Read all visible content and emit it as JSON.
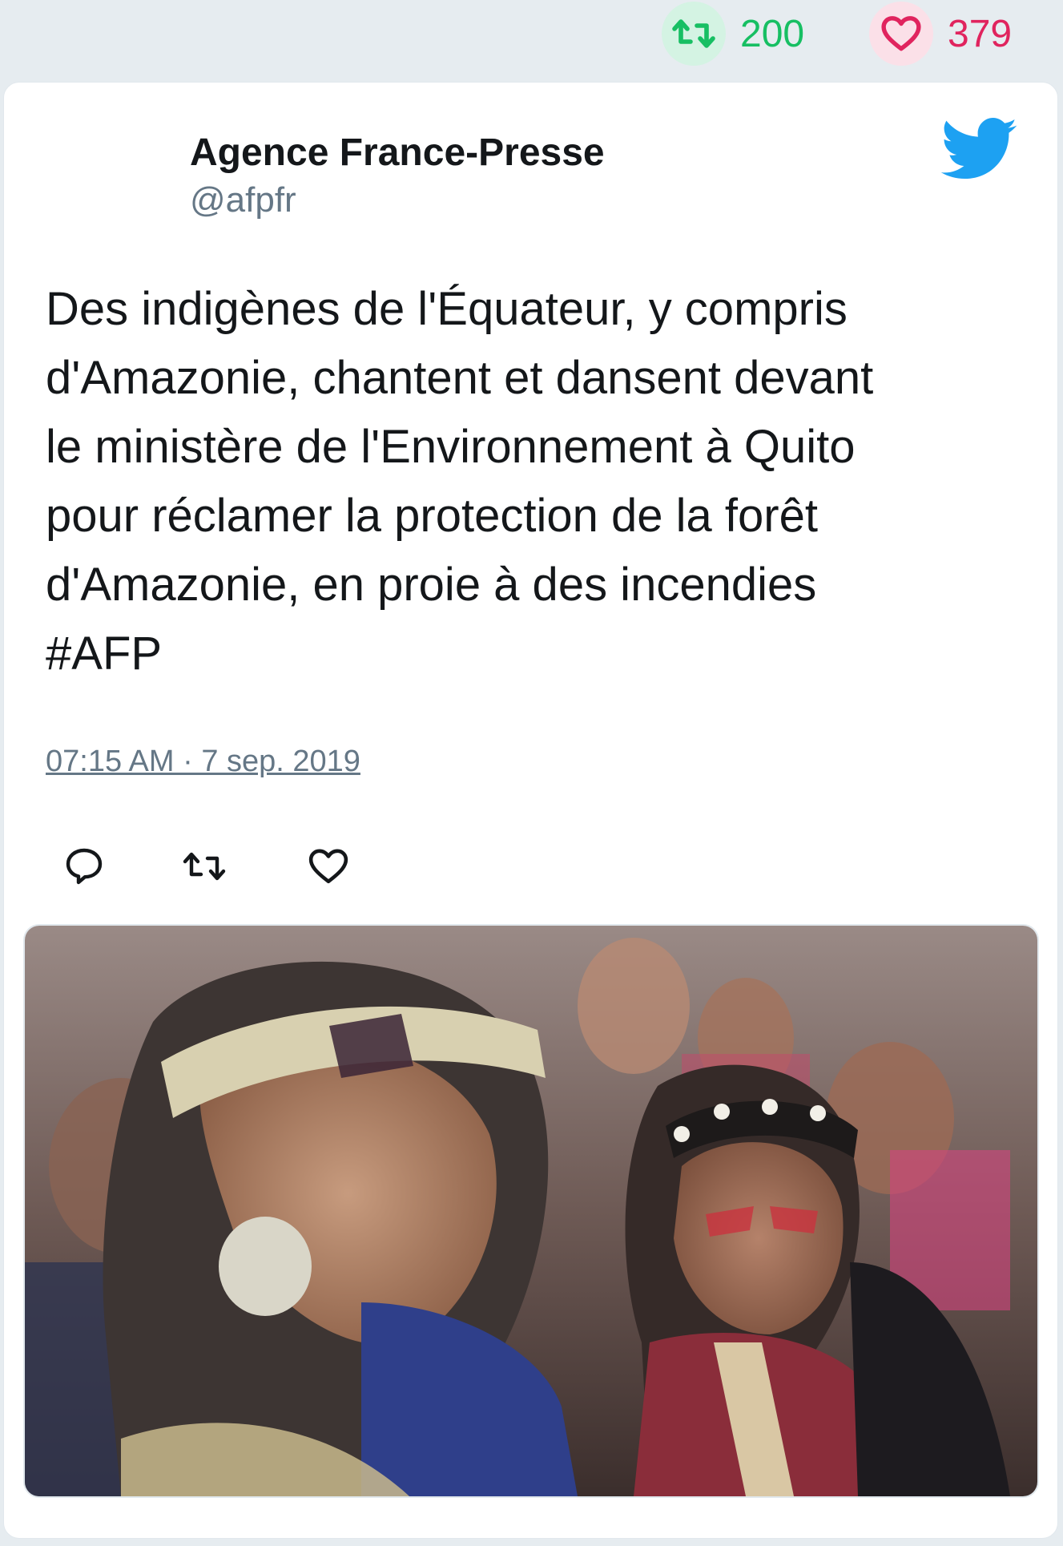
{
  "stats": {
    "retweets": "200",
    "likes": "379",
    "retweet_icon": "retweet-icon",
    "like_icon": "heart-icon"
  },
  "tweet": {
    "author_name": "Agence France-Presse",
    "author_handle": "@afpfr",
    "text": "Des indigènes de l'Équateur, y compris\nd'Amazonie, chantent et dansent devant\nle ministère de l'Environnement à Quito\npour réclamer la protection de la forêt\nd'Amazonie, en proie à des incendies\n#AFP",
    "timestamp": "07:15 AM · 7 sep. 2019",
    "platform_icon": "twitter-bird-icon"
  },
  "actions": [
    {
      "icon": "reply-icon"
    },
    {
      "icon": "retweet-icon"
    },
    {
      "icon": "heart-icon"
    }
  ],
  "colors": {
    "retweet_green": "#17bf63",
    "like_red": "#e0245e",
    "twitter_blue": "#1da1f2",
    "secondary_text": "#657786",
    "background": "#e6ecf0"
  }
}
